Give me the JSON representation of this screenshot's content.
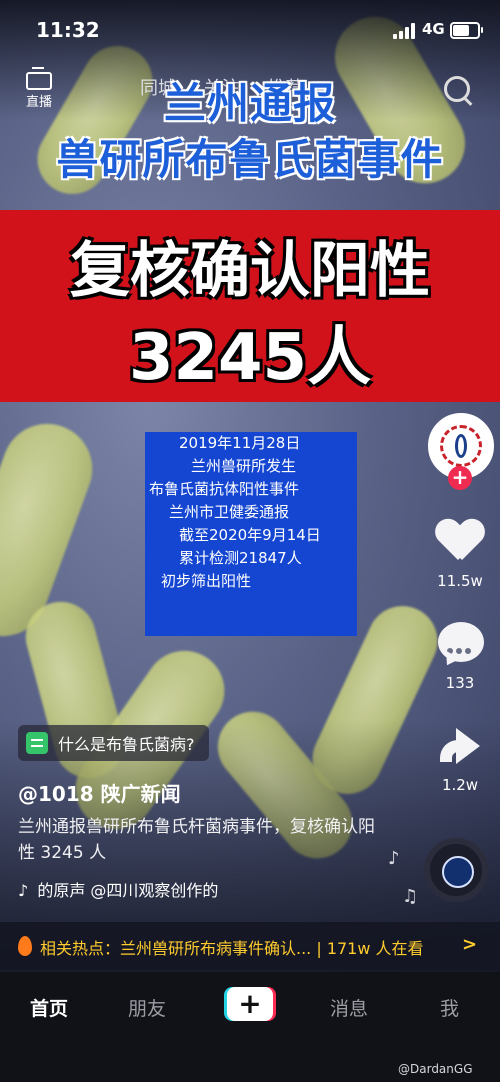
{
  "status_bar": {
    "time": "11:32",
    "network": "4G"
  },
  "top_nav": {
    "live_label": "直播",
    "tabs": [
      "同城",
      "关注",
      "推荐"
    ]
  },
  "headline": {
    "line1": "兰州通报",
    "line2": "兽研所布鲁氏菌事件"
  },
  "banner": {
    "line1": "复核确认阳性",
    "line2": "3245人"
  },
  "info_card": {
    "lines": [
      "2019年11月28日",
      "兰州兽研所发生",
      "布鲁氏菌抗体阳性事件",
      "兰州市卫健委通报",
      "截至2020年9月14日",
      "累计检测21847人",
      "初步筛出阳性"
    ]
  },
  "right_rail": {
    "likes": "11.5w",
    "comments": "133",
    "shares": "1.2w"
  },
  "topic_tag": {
    "text": "什么是布鲁氏菌病?"
  },
  "post": {
    "author": "@1018 陕广新闻",
    "description": "兰州通报兽研所布鲁氏杆菌病事件，复核确认阳性 3245 人",
    "music": "的原声    @四川观察创作的"
  },
  "hot_topic": {
    "text": "相关热点：兰州兽研所布病事件确认... | 171w 人在看"
  },
  "bottom_nav": {
    "home": "首页",
    "friends": "朋友",
    "messages": "消息",
    "me": "我"
  },
  "watermark": "@DardanGG",
  "colors": {
    "accent_red": "#fe2c55",
    "accent_cyan": "#26d3e0",
    "hot_yellow": "#ffcb2e",
    "card_blue": "#1446d2"
  }
}
